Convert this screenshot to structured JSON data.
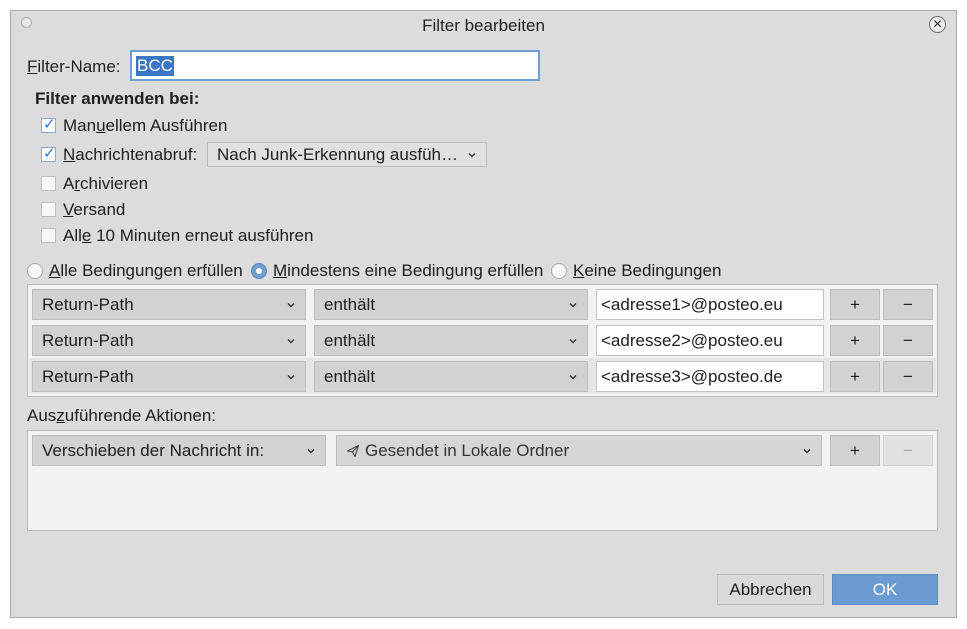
{
  "window": {
    "title": "Filter bearbeiten"
  },
  "filter_name": {
    "label_pre": "",
    "label_u": "F",
    "label_post": "ilter-Name:",
    "value": "BCC"
  },
  "apply_section": {
    "heading": "Filter anwenden bei:"
  },
  "options": [
    {
      "pre": "Man",
      "u": "u",
      "post": "ellem Ausführen",
      "checked": true
    },
    {
      "pre": "",
      "u": "N",
      "post": "achrichtenabruf:",
      "checked": true
    },
    {
      "pre": "A",
      "u": "r",
      "post": "chivieren",
      "checked": false
    },
    {
      "pre": "",
      "u": "V",
      "post": "ersand",
      "checked": false
    },
    {
      "pre": "All",
      "u": "e",
      "post": " 10 Minuten erneut ausführen",
      "checked": false
    }
  ],
  "junk_select": {
    "value": "Nach Junk-Erkennung ausfüh…"
  },
  "match": {
    "all": {
      "pre": "",
      "u": "A",
      "post": "lle Bedingungen erfüllen",
      "selected": false
    },
    "any": {
      "pre": "",
      "u": "M",
      "post": "indestens eine Bedingung erfüllen",
      "selected": true
    },
    "none": {
      "pre": "",
      "u": "K",
      "post": "eine Bedingungen",
      "selected": false
    }
  },
  "conditions": [
    {
      "field": "Return-Path",
      "operator": "enthält",
      "value": "<adresse1>@posteo.eu",
      "add": "+",
      "remove": "−"
    },
    {
      "field": "Return-Path",
      "operator": "enthält",
      "value": "<adresse2>@posteo.eu",
      "add": "+",
      "remove": "−"
    },
    {
      "field": "Return-Path",
      "operator": "enthält",
      "value": "<adresse3>@posteo.de",
      "add": "+",
      "remove": "−"
    }
  ],
  "actions_section": {
    "pre": "Aus",
    "u": "z",
    "post": "uführende Aktionen:"
  },
  "actions": [
    {
      "action": "Verschieben der Nachricht in:",
      "target": "Gesendet in Lokale Ordner",
      "add": "+",
      "remove": "−"
    }
  ],
  "footer": {
    "cancel_label": "Abbrechen",
    "ok_label": "OK"
  },
  "colors": {
    "accent": "#6c9bd2",
    "selection": "#3a76c4",
    "dialog_bg": "#dcdcdc"
  },
  "icons": {
    "close": "close-icon",
    "chevron": "chevron-down-icon",
    "folder_target": "paper-plane-icon"
  }
}
